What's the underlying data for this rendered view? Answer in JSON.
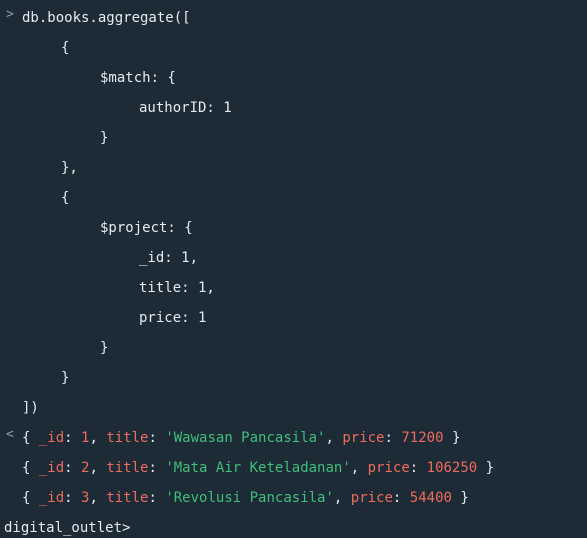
{
  "input": {
    "prompt_glyph": ">",
    "lines": [
      "db.books.aggregate([",
      "{",
      "$match: {",
      "authorID: 1",
      "}",
      "},",
      "{",
      "$project: {",
      "_id: 1,",
      "title: 1,",
      "price: 1",
      "}",
      "}",
      "])"
    ]
  },
  "output": {
    "glyph": "<",
    "results": [
      {
        "id_key": "_id",
        "id_val": "1",
        "title_key": "title",
        "title_val": "'Wawasan Pancasila'",
        "price_key": "price",
        "price_val": "71200"
      },
      {
        "id_key": "_id",
        "id_val": "2",
        "title_key": "title",
        "title_val": "'Mata Air Keteladanan'",
        "price_key": "price",
        "price_val": "106250"
      },
      {
        "id_key": "_id",
        "id_val": "3",
        "title_key": "title",
        "title_val": "'Revolusi Pancasila'",
        "price_key": "price",
        "price_val": "54400"
      }
    ]
  },
  "prompt": {
    "db_name": "digital_outlet",
    "glyph": ">"
  },
  "colors": {
    "background": "#1c2b36",
    "key": "#ef6b5d",
    "string": "#3fbf7a",
    "text": "#e6ebef"
  }
}
